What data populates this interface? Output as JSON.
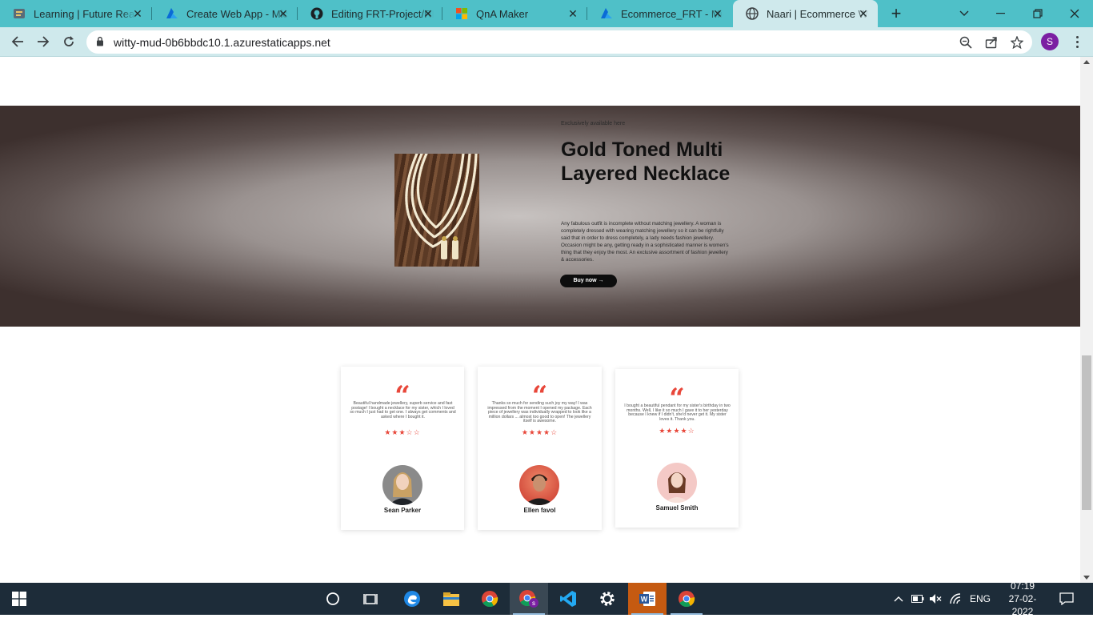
{
  "browser": {
    "tabs": [
      {
        "title": "Learning | Future Read",
        "icon": "learning-favicon",
        "active": false
      },
      {
        "title": "Create Web App - Mic",
        "icon": "azure-favicon",
        "active": false
      },
      {
        "title": "Editing FRT-Project/RE",
        "icon": "github-favicon",
        "active": false
      },
      {
        "title": "QnA Maker",
        "icon": "microsoft-favicon",
        "active": false
      },
      {
        "title": "Ecommerce_FRT - Mic",
        "icon": "azure-favicon",
        "active": false
      },
      {
        "title": "Naari | Ecommerce We",
        "icon": "globe-favicon",
        "active": true
      }
    ],
    "url": "witty-mud-0b6bbdc10.1.azurestaticapps.net",
    "profile_initial": "S",
    "accent": "#4fc0c8"
  },
  "hero": {
    "eyebrow": "Exclusively available here",
    "title": "Gold Toned Multi Layered Necklace",
    "description": "Any fabulous outfit is incomplete without matching jewellery. A woman is completely dressed with wearing matching jewellery so it can be rightfully said that in order to dress completely, a lady needs fashion jewellery. Occasion might be any, getting ready in a sophisticated manner is women's thing that they enjoy the most. An exclusive assortment of fashion jewellery & accessories.",
    "button_label": "Buy now →"
  },
  "testimonials": [
    {
      "text": "Beautiful handmade jewellery, superb service and fast postage! I bought a necklace for my sister, which I loved so much I just had to get one. I always get comments and asked where I bought it.",
      "stars": "★★★☆☆",
      "rating": 3,
      "name": "Sean Parker"
    },
    {
      "text": "Thanks so much for sending such joy my way! I was impressed from the moment I opened my package. Each piece of jewellery was individually wrapped to look like a million dollars ... almost too good to open! The jewellery itself is awesome.",
      "stars": "★★★★☆",
      "rating": 4,
      "name": "Ellen favol"
    },
    {
      "text": "I bought a beautiful pendant for my sister's birthday in two months. Well, I like it so much I gave it to her yesterday because I knew if I didn't, she'd never get it. My sister loves it. Thank you.",
      "stars": "★★★★☆",
      "rating": 4,
      "name": "Samuel Smith"
    }
  ],
  "taskbar": {
    "apps": [
      "search-icon",
      "task-view-icon",
      "edge-icon",
      "file-explorer-icon",
      "chrome-icon",
      "chrome-profile-icon",
      "vscode-icon",
      "settings-icon",
      "word-icon",
      "chrome-icon"
    ],
    "language": "ENG",
    "time": "07:19",
    "date": "27-02-2022"
  },
  "colors": {
    "quote_red": "#e8473a",
    "taskbar": "#1d2c39"
  }
}
